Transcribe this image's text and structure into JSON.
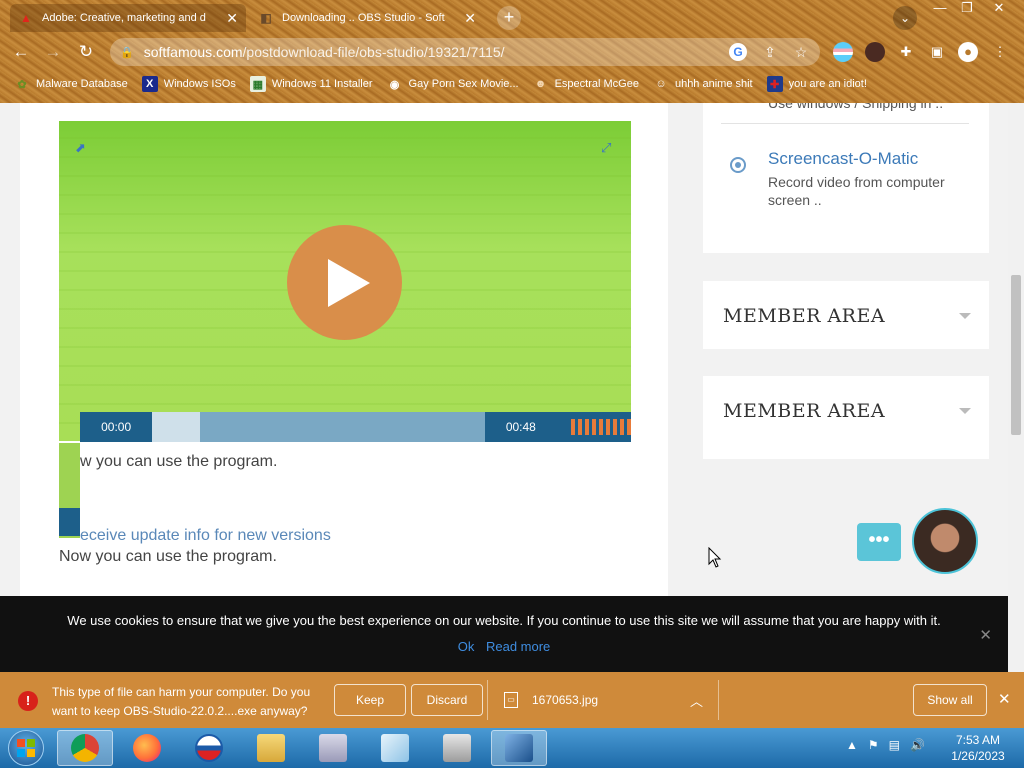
{
  "browser": {
    "tabs": [
      {
        "title": "Adobe: Creative, marketing and d",
        "favicon": "adobe-icon",
        "active": true
      },
      {
        "title": "Downloading .. OBS Studio - Soft",
        "favicon": "softfamous-icon",
        "active": false
      }
    ],
    "new_tab_symbol": "+",
    "url_host": "softfamous.com",
    "url_path": "/postdownload-file/obs-studio/19321/7115/",
    "bookmarks": [
      {
        "label": "Malware Database",
        "icon": "plant-icon"
      },
      {
        "label": "Windows ISOs",
        "icon": "x-icon"
      },
      {
        "label": "Windows 11 Installer",
        "icon": "image-icon"
      },
      {
        "label": "Gay Porn Sex Movie...",
        "icon": "globe-icon"
      },
      {
        "label": "Espectral McGee",
        "icon": "face-icon"
      },
      {
        "label": "uhhh anime shit",
        "icon": "anime-icon"
      },
      {
        "label": "you are an idiot!",
        "icon": "flag-uk-icon"
      }
    ]
  },
  "video": {
    "current_time": "00:00",
    "duration": "00:48"
  },
  "main": {
    "ghost_line": "w you can use the program.",
    "ghost_link": "eceive update info for new versions",
    "body_text": "Now you can use the program."
  },
  "sidebar": {
    "prev_item_desc": "Use windows / Shipping in ..",
    "screencast": {
      "title": "Screencast-O-Matic",
      "desc": "Record video from computer screen .."
    },
    "member_area_1": "MEMBER AREA",
    "member_area_2": "MEMBER AREA"
  },
  "chat": {
    "bubble_text": "•••"
  },
  "cookie": {
    "message": "We use cookies to ensure that we give you the best experience on our website. If you continue to use this site we will assume that you are happy with it.",
    "ok_label": "Ok",
    "read_more_label": "Read more",
    "close_symbol": "✕"
  },
  "download": {
    "warning": "This type of file can harm your computer. Do you want to keep OBS-Studio-22.0.2....exe anyway?",
    "keep_label": "Keep",
    "discard_label": "Discard",
    "file_name": "1670653.jpg",
    "show_all_label": "Show all"
  },
  "taskbar": {
    "time": "7:53 AM",
    "date": "1/26/2023"
  },
  "colors": {
    "chrome_theme": "#b87a2c",
    "video_green": "#a7e05b",
    "play_orange": "#d98e4a",
    "control_blue": "#1d5f8a",
    "link_blue": "#3c7ab8",
    "download_bar": "#cf8a3a"
  }
}
